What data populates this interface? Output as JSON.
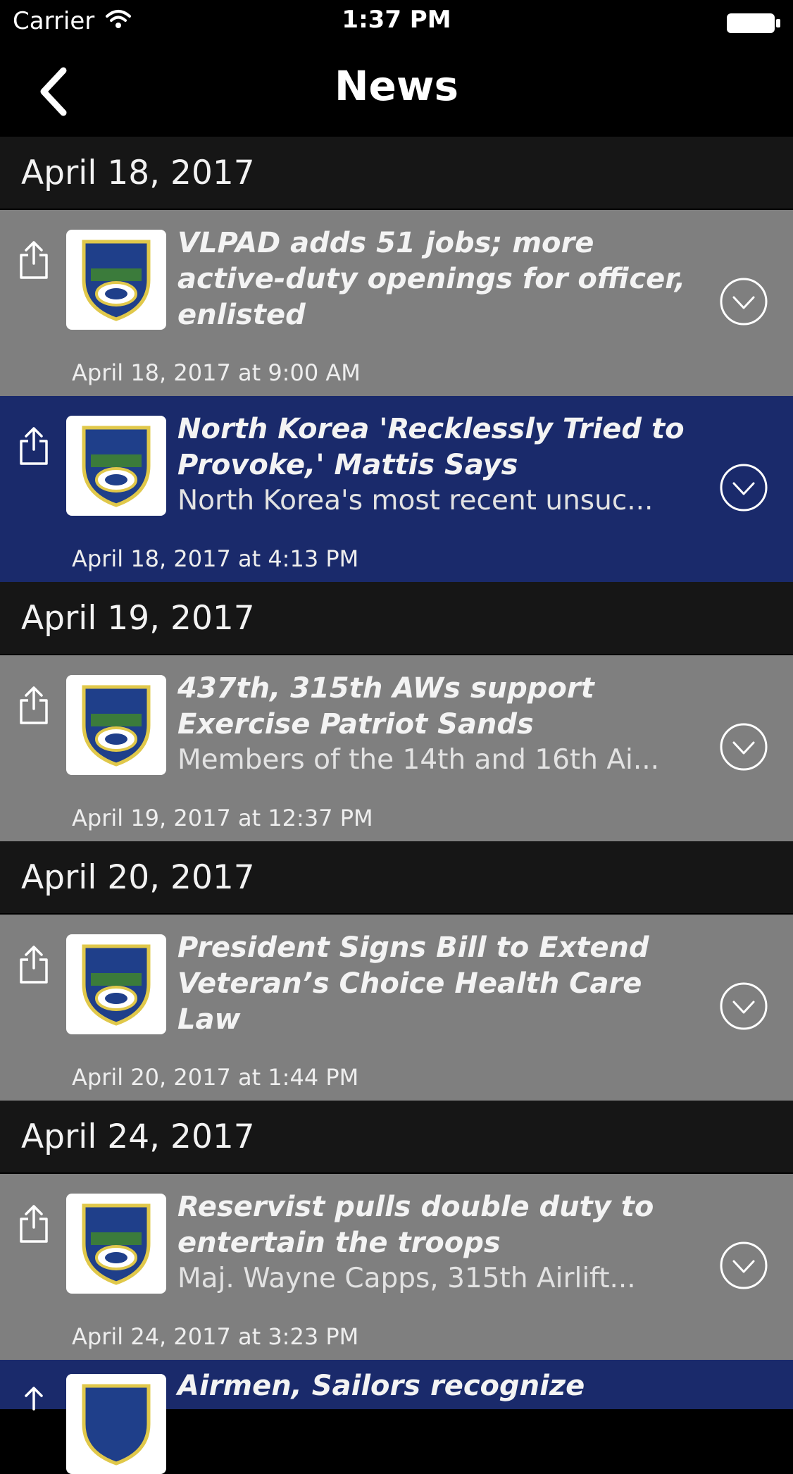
{
  "status_bar": {
    "carrier": "Carrier",
    "time": "1:37 PM"
  },
  "nav": {
    "title": "News"
  },
  "sections": [
    {
      "date": "April 18, 2017",
      "items": [
        {
          "title": "VLPAD adds 51 jobs; more active-duty openings for officer, enlisted",
          "summary": "",
          "timestamp": "April 18, 2017 at 9:00 AM",
          "selected": false
        },
        {
          "title": "North Korea 'Recklessly Tried to Provoke,' Mattis Says",
          "summary": "North Korea's most recent unsuc...",
          "timestamp": "April 18, 2017 at 4:13 PM",
          "selected": true
        }
      ]
    },
    {
      "date": "April 19, 2017",
      "items": [
        {
          "title": "437th, 315th AWs support Exercise Patriot Sands",
          "summary": "Members of the 14th and 16th Ai...",
          "timestamp": "April 19, 2017 at 12:37 PM",
          "selected": false
        }
      ]
    },
    {
      "date": "April 20, 2017",
      "items": [
        {
          "title": "President Signs Bill to Extend Veteran’s Choice Health Care Law",
          "summary": "",
          "timestamp": "April 20, 2017 at 1:44 PM",
          "selected": false
        }
      ]
    },
    {
      "date": "April 24, 2017",
      "items": [
        {
          "title": "Reservist pulls double duty to entertain the troops",
          "summary": "Maj. Wayne Capps, 315th Airlift...",
          "timestamp": "April 24, 2017 at 3:23 PM",
          "selected": false
        },
        {
          "title": "Airmen, Sailors recognize",
          "summary": "",
          "timestamp": "",
          "selected": true
        }
      ]
    }
  ],
  "colors": {
    "row_bg": "#7f7f7f",
    "row_selected_bg": "#1a2a6b",
    "section_bg": "#161616"
  }
}
